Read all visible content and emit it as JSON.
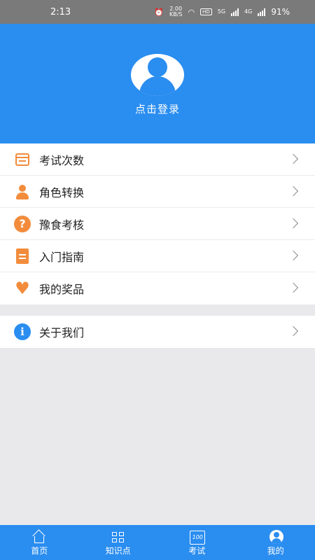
{
  "status_bar": {
    "time": "2:13",
    "net_speed_value": "2.00",
    "net_speed_unit": "KB/S",
    "hd_label": "HD",
    "sim1_label": "5G",
    "sim2_label": "4G",
    "battery": "91%"
  },
  "header": {
    "login_text": "点击登录"
  },
  "menu": [
    {
      "label": "考试次数",
      "icon": "calendar-icon"
    },
    {
      "label": "角色转换",
      "icon": "user-icon"
    },
    {
      "label": "豫食考核",
      "icon": "question-icon"
    },
    {
      "label": "入门指南",
      "icon": "document-icon"
    },
    {
      "label": "我的奖品",
      "icon": "heart-icon"
    }
  ],
  "menu2": [
    {
      "label": "关于我们",
      "icon": "info-icon"
    }
  ],
  "tabbar": {
    "tabs": [
      {
        "label": "首页",
        "icon": "home-icon"
      },
      {
        "label": "知识点",
        "icon": "grid-icon"
      },
      {
        "label": "考试",
        "icon": "exam-icon",
        "icon_text": "100"
      },
      {
        "label": "我的",
        "icon": "profile-icon",
        "active": true
      }
    ]
  },
  "colors": {
    "primary": "#2a8df0",
    "accent_orange": "#f28c3c",
    "background": "#e9e9ec"
  }
}
